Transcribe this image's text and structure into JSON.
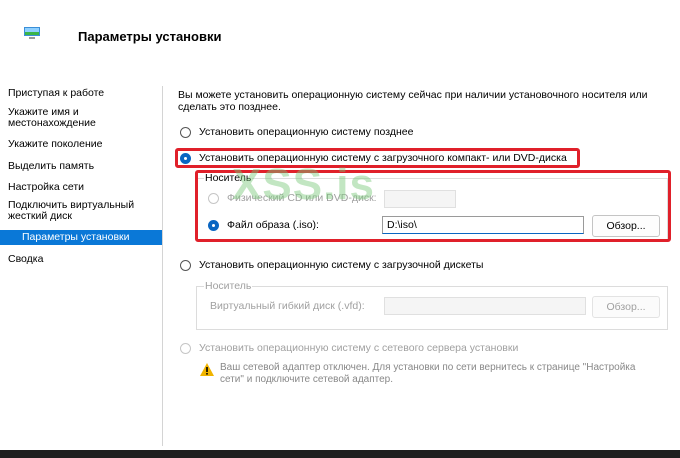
{
  "header": {
    "title": "Параметры установки",
    "icon": "virtual-machine-icon"
  },
  "sidebar": {
    "items": [
      {
        "label": "Приступая к работе"
      },
      {
        "label": "Укажите имя и местонахождение"
      },
      {
        "label": "Укажите поколение"
      },
      {
        "label": "Выделить память"
      },
      {
        "label": "Настройка сети"
      },
      {
        "label": "Подключить виртуальный жесткий диск"
      },
      {
        "label": "Параметры установки",
        "selected": true
      },
      {
        "label": "Сводка"
      }
    ]
  },
  "content": {
    "description": "Вы можете установить операционную систему сейчас при наличии установочного носителя или сделать это позднее.",
    "option_later": "Установить операционную систему позднее",
    "option_dvd": "Установить операционную систему с загрузочного компакт- или DVD-диска",
    "dvd_group_label": "Носитель",
    "dvd_physical": "Физический CD или DVD-диск:",
    "dvd_image": "Файл образа (.iso):",
    "dvd_image_path": "D:\\iso\\",
    "browse_label": "Обзор...",
    "option_floppy": "Установить операционную систему с загрузочной дискеты",
    "floppy_group_label": "Носитель",
    "floppy_label": "Виртуальный гибкий диск (.vfd):",
    "floppy_browse": "Обзор...",
    "option_network": "Установить операционную систему с сетевого сервера установки",
    "network_warning": "Ваш сетевой адаптер отключен. Для установки по сети вернитесь к странице \"Настройка сети\" и подключите сетевой адаптер."
  },
  "watermark": "XSS.is",
  "colors": {
    "accent": "#0a78d7",
    "highlight_border": "#e0202a",
    "warning": "#f0b400"
  }
}
